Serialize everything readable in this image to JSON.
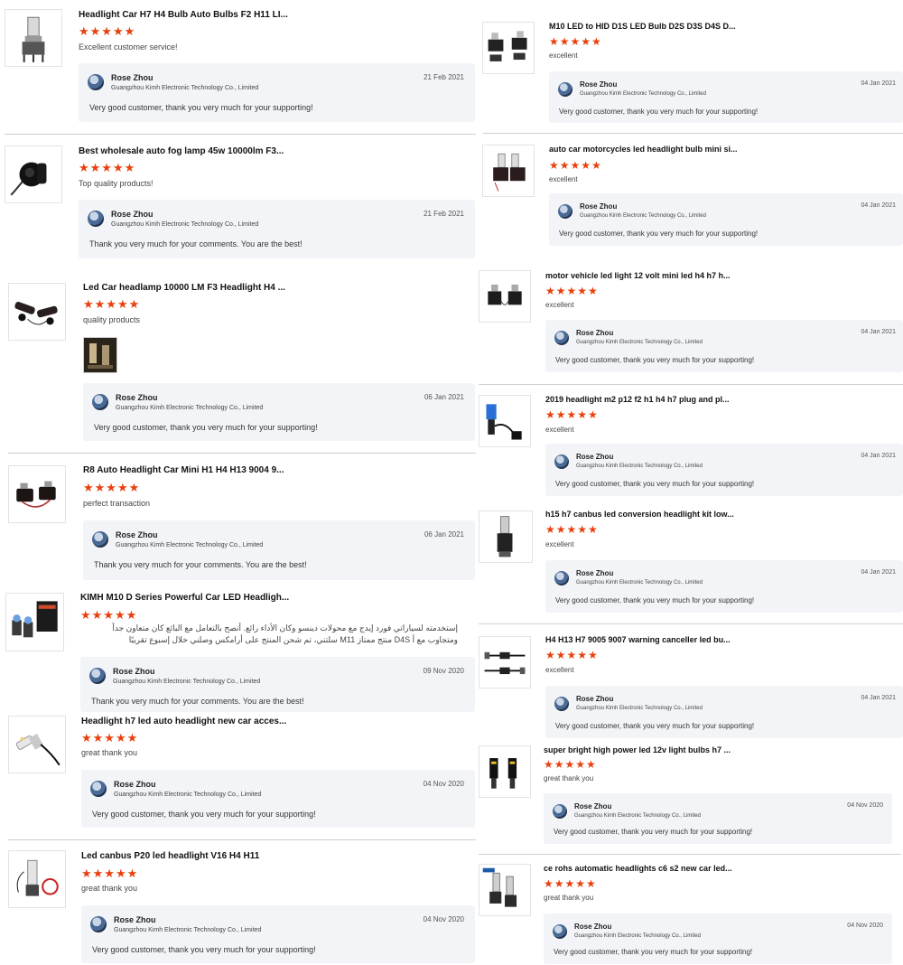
{
  "left": [
    {
      "title": "Headlight Car H7 H4 Bulb Auto Bulbs F2 H11 LI...",
      "comment": "Excellent customer service!",
      "rating": 5,
      "reply": {
        "name": "Rose Zhou",
        "company": "Guangzhou Kimh Electronic Technology Co., Limited",
        "date": "21 Feb 2021",
        "text": "Very good customer, thank you very much for your supporting!"
      },
      "icon": "led-bulb-icon"
    },
    {
      "title": "Best wholesale auto fog lamp 45w 10000lm F3...",
      "comment": "Top quality products!",
      "rating": 5,
      "reply": {
        "name": "Rose Zhou",
        "company": "Guangzhou Kimh Electronic Technology Co., Limited",
        "date": "21 Feb 2021",
        "text": "Thank you very much for your comments. You are the best!"
      },
      "icon": "fog-lamp-icon"
    },
    {
      "title": "Led Car headlamp 10000 LM F3 Headlight H4 ...",
      "comment": "quality products",
      "rating": 5,
      "reply": {
        "name": "Rose Zhou",
        "company": "Guangzhou Kimh Electronic Technology Co., Limited",
        "date": "06 Jan 2021",
        "text": "Very good customer, thank you very much for your supporting!"
      },
      "icon": "headlamp-pair-icon"
    },
    {
      "title": "R8 Auto Headlight Car Mini H1 H4 H13 9004 9...",
      "comment": "perfect transaction",
      "rating": 5,
      "reply": {
        "name": "Rose Zhou",
        "company": "Guangzhou Kimh Electronic Technology Co., Limited",
        "date": "06 Jan 2021",
        "text": "Thank you very much for your comments. You are the best!"
      },
      "icon": "mini-headlight-icon"
    },
    {
      "title": "KIMH M10 D Series Powerful Car LED Headligh...",
      "comment": "إستخدمته لسياراتي فورد إيدج مع محولات دينسو وكان الأداء رائع. أنصح بالتعامل مع البائع كان متعاون جداً ومتجاوب مع أ D4S منتج ممتاز M11 سلتني، تم شحن المنتج على أرامكس وصلني خلال إسبوع تقريبًا",
      "rating": 5,
      "reply": {
        "name": "Rose Zhou",
        "company": "Guangzhou Kimh Electronic Technology Co., Limited",
        "date": "09 Nov 2020",
        "text": "Thank you very much for your comments. You are the best!"
      },
      "icon": "led-box-icon"
    },
    {
      "title": "Headlight h7 led auto headlight new car acces...",
      "comment": "great thank you",
      "rating": 5,
      "reply": {
        "name": "Rose Zhou",
        "company": "Guangzhou Kimh Electronic Technology Co., Limited",
        "date": "04 Nov 2020",
        "text": "Very good customer, thank you very much for your supporting!"
      },
      "icon": "h7-bulb-icon"
    },
    {
      "title": "Led canbus P20 led headlight V16 H4 H11",
      "comment": "great thank you",
      "rating": 5,
      "reply": {
        "name": "Rose Zhou",
        "company": "Guangzhou Kimh Electronic Technology Co., Limited",
        "date": "04 Nov 2020",
        "text": "Very good customer, thank you very much for your supporting!"
      },
      "icon": "canbus-bulb-icon"
    }
  ],
  "right": [
    {
      "title": "M10 LED to HID D1S LED Bulb D2S D3S D4S D...",
      "comment": "excellent",
      "rating": 5,
      "reply": {
        "name": "Rose Zhou",
        "company": "Guangzhou Kimh Electronic Technology Co., Limited",
        "date": "04 Jan 2021",
        "text": "Very good customer, thank you very much for your supporting!"
      },
      "icon": "hid-bulb-icon"
    },
    {
      "title": "auto car motorcycles led headlight bulb mini si...",
      "comment": "excellent",
      "rating": 5,
      "reply": {
        "name": "Rose Zhou",
        "company": "Guangzhou Kimh Electronic Technology Co., Limited",
        "date": "04 Jan 2021",
        "text": "Very good customer, thank you very much for your supporting!"
      },
      "icon": "moto-bulb-icon"
    },
    {
      "title": "motor vehicle led light 12 volt mini led h4 h7 h...",
      "comment": "excellent",
      "rating": 5,
      "reply": {
        "name": "Rose Zhou",
        "company": "Guangzhou Kimh Electronic Technology Co., Limited",
        "date": "04 Jan 2021",
        "text": "Very good customer, thank you very much for your supporting!"
      },
      "icon": "mini-led-icon"
    },
    {
      "title": "2019 headlight m2 p12 f2 h1 h4 h7 plug and pl...",
      "comment": "excellent",
      "rating": 5,
      "reply": {
        "name": "Rose Zhou",
        "company": "Guangzhou Kimh Electronic Technology Co., Limited",
        "date": "04 Jan 2021",
        "text": "Very good customer, thank you very much for your supporting!"
      },
      "icon": "plug-bulb-icon"
    },
    {
      "title": "h15 h7 canbus led conversion headlight kit low...",
      "comment": "excellent",
      "rating": 5,
      "reply": {
        "name": "Rose Zhou",
        "company": "Guangzhou Kimh Electronic Technology Co., Limited",
        "date": "04 Jan 2021",
        "text": "Very good customer, thank you very much for your supporting!"
      },
      "icon": "conversion-kit-icon"
    },
    {
      "title": "H4 H13 H7 9005 9007 warning canceller led bu...",
      "comment": "excellent",
      "rating": 5,
      "reply": {
        "name": "Rose Zhou",
        "company": "Guangzhou Kimh Electronic Technology Co., Limited",
        "date": "04 Jan 2021",
        "text": "Very good customer, thank you very much for your supporting!"
      },
      "icon": "canceller-icon"
    },
    {
      "title": "super bright high power led 12v light bulbs h7 ...",
      "comment": "great thank you",
      "rating": 5,
      "reply": {
        "name": "Rose Zhou",
        "company": "Guangzhou Kimh Electronic Technology Co., Limited",
        "date": "04 Nov 2020",
        "text": "Very good customer, thank you very much for your supporting!"
      },
      "icon": "bright-bulb-icon"
    },
    {
      "title": "ce rohs automatic headlights c6 s2 new car led...",
      "comment": "great thank you",
      "rating": 5,
      "reply": {
        "name": "Rose Zhou",
        "company": "Guangzhou Kimh Electronic Technology Co., Limited",
        "date": "04 Nov 2020",
        "text": "Very good customer, thank you very much for your supporting!"
      },
      "icon": "c6-bulb-icon"
    }
  ],
  "colors": {
    "star": "#e8400c",
    "reply_bg": "#f3f4f7",
    "divider": "#cfcfcf"
  }
}
